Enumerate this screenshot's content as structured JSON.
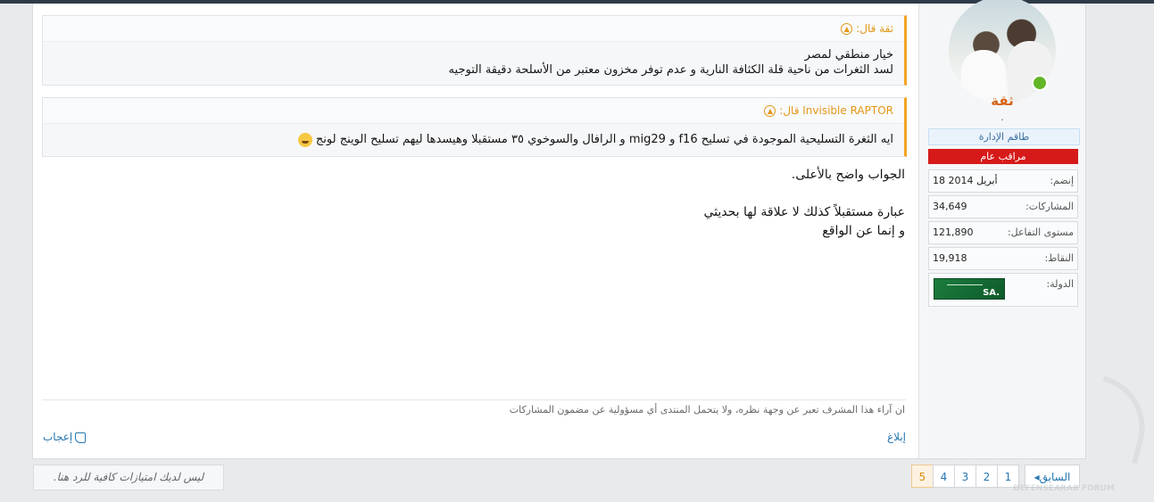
{
  "user": {
    "name": "ثقة",
    "subtitle": ".",
    "role_badge": "طاقم الإدارة",
    "rank_badge": "مراقب عام",
    "stats": [
      {
        "key": "إنضم:",
        "value": "18 أبريل 2014"
      },
      {
        "key": "المشاركات:",
        "value": "34,649"
      },
      {
        "key": "مستوى التفاعل:",
        "value": "121,890"
      },
      {
        "key": "النقاط:",
        "value": "19,918"
      }
    ],
    "country_label": "الدولة:",
    "country_flag_text": "SA."
  },
  "quotes": [
    {
      "author_line": "ثقة قال:",
      "lines": [
        "خيار منطقي لمصر",
        "لسد الثغرات من ناحية قلة الكثافة النارية و عدم توفر مخزون معتبر من الأسلحة دقيقة التوجيه"
      ]
    },
    {
      "author_line": "Invisible RAPTOR قال:",
      "lines": [
        "ايه الثغرة التسليحية الموجودة في تسليح f16 و mig29 و الرافال والسوخوي ٣٥ مستقبلا وهيسدها ليهم تسليح الوينج لونج"
      ]
    }
  ],
  "reply_lines": [
    "الجواب واضح بالأعلى.",
    "",
    "عبارة مستقبلاً كذلك لا علاقة لها بحديثي",
    "و إنما عن الواقع"
  ],
  "signature": "ان آراء هذا المشرف تعبر عن وجهة نظره، ولا يتحمل المنتدى أي مسؤولية عن مضمون المشاركات",
  "actions": {
    "report": "إبلاغ",
    "like": "إعجاب"
  },
  "pagination": {
    "prev": "السابق",
    "pages": [
      "1",
      "2",
      "3",
      "4",
      "5"
    ],
    "current": "5"
  },
  "no_reply_notice": "ليس لديك امتيازات كافية للرد هنا.",
  "watermark": "DEFENSEARAB FORUM"
}
